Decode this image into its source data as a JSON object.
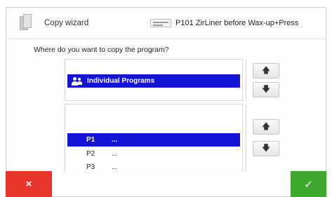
{
  "header": {
    "title": "Copy wizard",
    "program": "P101  ZirLiner before Wax-up+Press"
  },
  "question": "Where do you want to copy the program?",
  "group_list": {
    "selected": "Individual Programs"
  },
  "program_list": {
    "rows": [
      {
        "num": "P1",
        "name": "...",
        "selected": true
      },
      {
        "num": "P2",
        "name": "...",
        "selected": false
      },
      {
        "num": "P3",
        "name": "...",
        "selected": false
      }
    ]
  },
  "buttons": {
    "up": "🡅",
    "down": "🡇",
    "cancel": "×",
    "ok": "✓"
  },
  "icons": {
    "app": "copy-pages-icon",
    "brand": "brand-logo",
    "group": "users-group-icon"
  },
  "colors": {
    "selection": "#1414d6",
    "cancel": "#e8362c",
    "ok": "#3fa92f"
  }
}
